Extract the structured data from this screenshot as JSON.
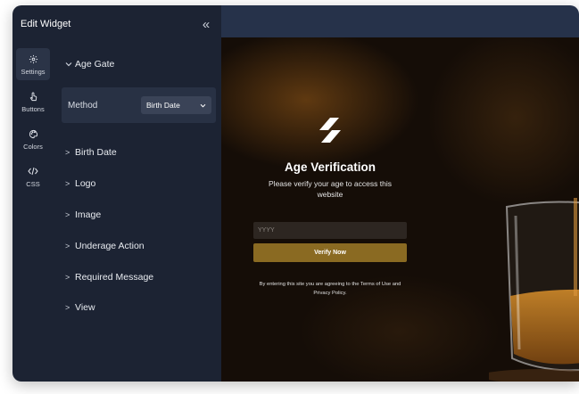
{
  "editor": {
    "title": "Edit Widget",
    "collapse_icon": "double-chevron-left-icon",
    "rail": [
      {
        "label": "Settings",
        "icon": "gear-icon",
        "active": true
      },
      {
        "label": "Buttons",
        "icon": "pointer-icon",
        "active": false
      },
      {
        "label": "Colors",
        "icon": "palette-icon",
        "active": false
      },
      {
        "label": "CSS",
        "icon": "code-icon",
        "active": false
      }
    ],
    "age_gate": {
      "label": "Age Gate",
      "expanded": true,
      "method_label": "Method",
      "method_value": "Birth Date"
    },
    "sections": [
      {
        "label": "Birth Date"
      },
      {
        "label": "Logo"
      },
      {
        "label": "Image"
      },
      {
        "label": "Underage Action"
      },
      {
        "label": "Required Message"
      },
      {
        "label": "View"
      }
    ]
  },
  "preview": {
    "title": "Age Verification",
    "subtitle": "Please verify your age to access this website",
    "year_placeholder": "YYYY",
    "verify_label": "Verify Now",
    "disclaimer": "By entering this site you are agreeing to the Terms of Use and Privacy Policy.",
    "colors": {
      "button": "#8a6a22",
      "panel": "#1c2333",
      "header": "#26324a"
    }
  }
}
